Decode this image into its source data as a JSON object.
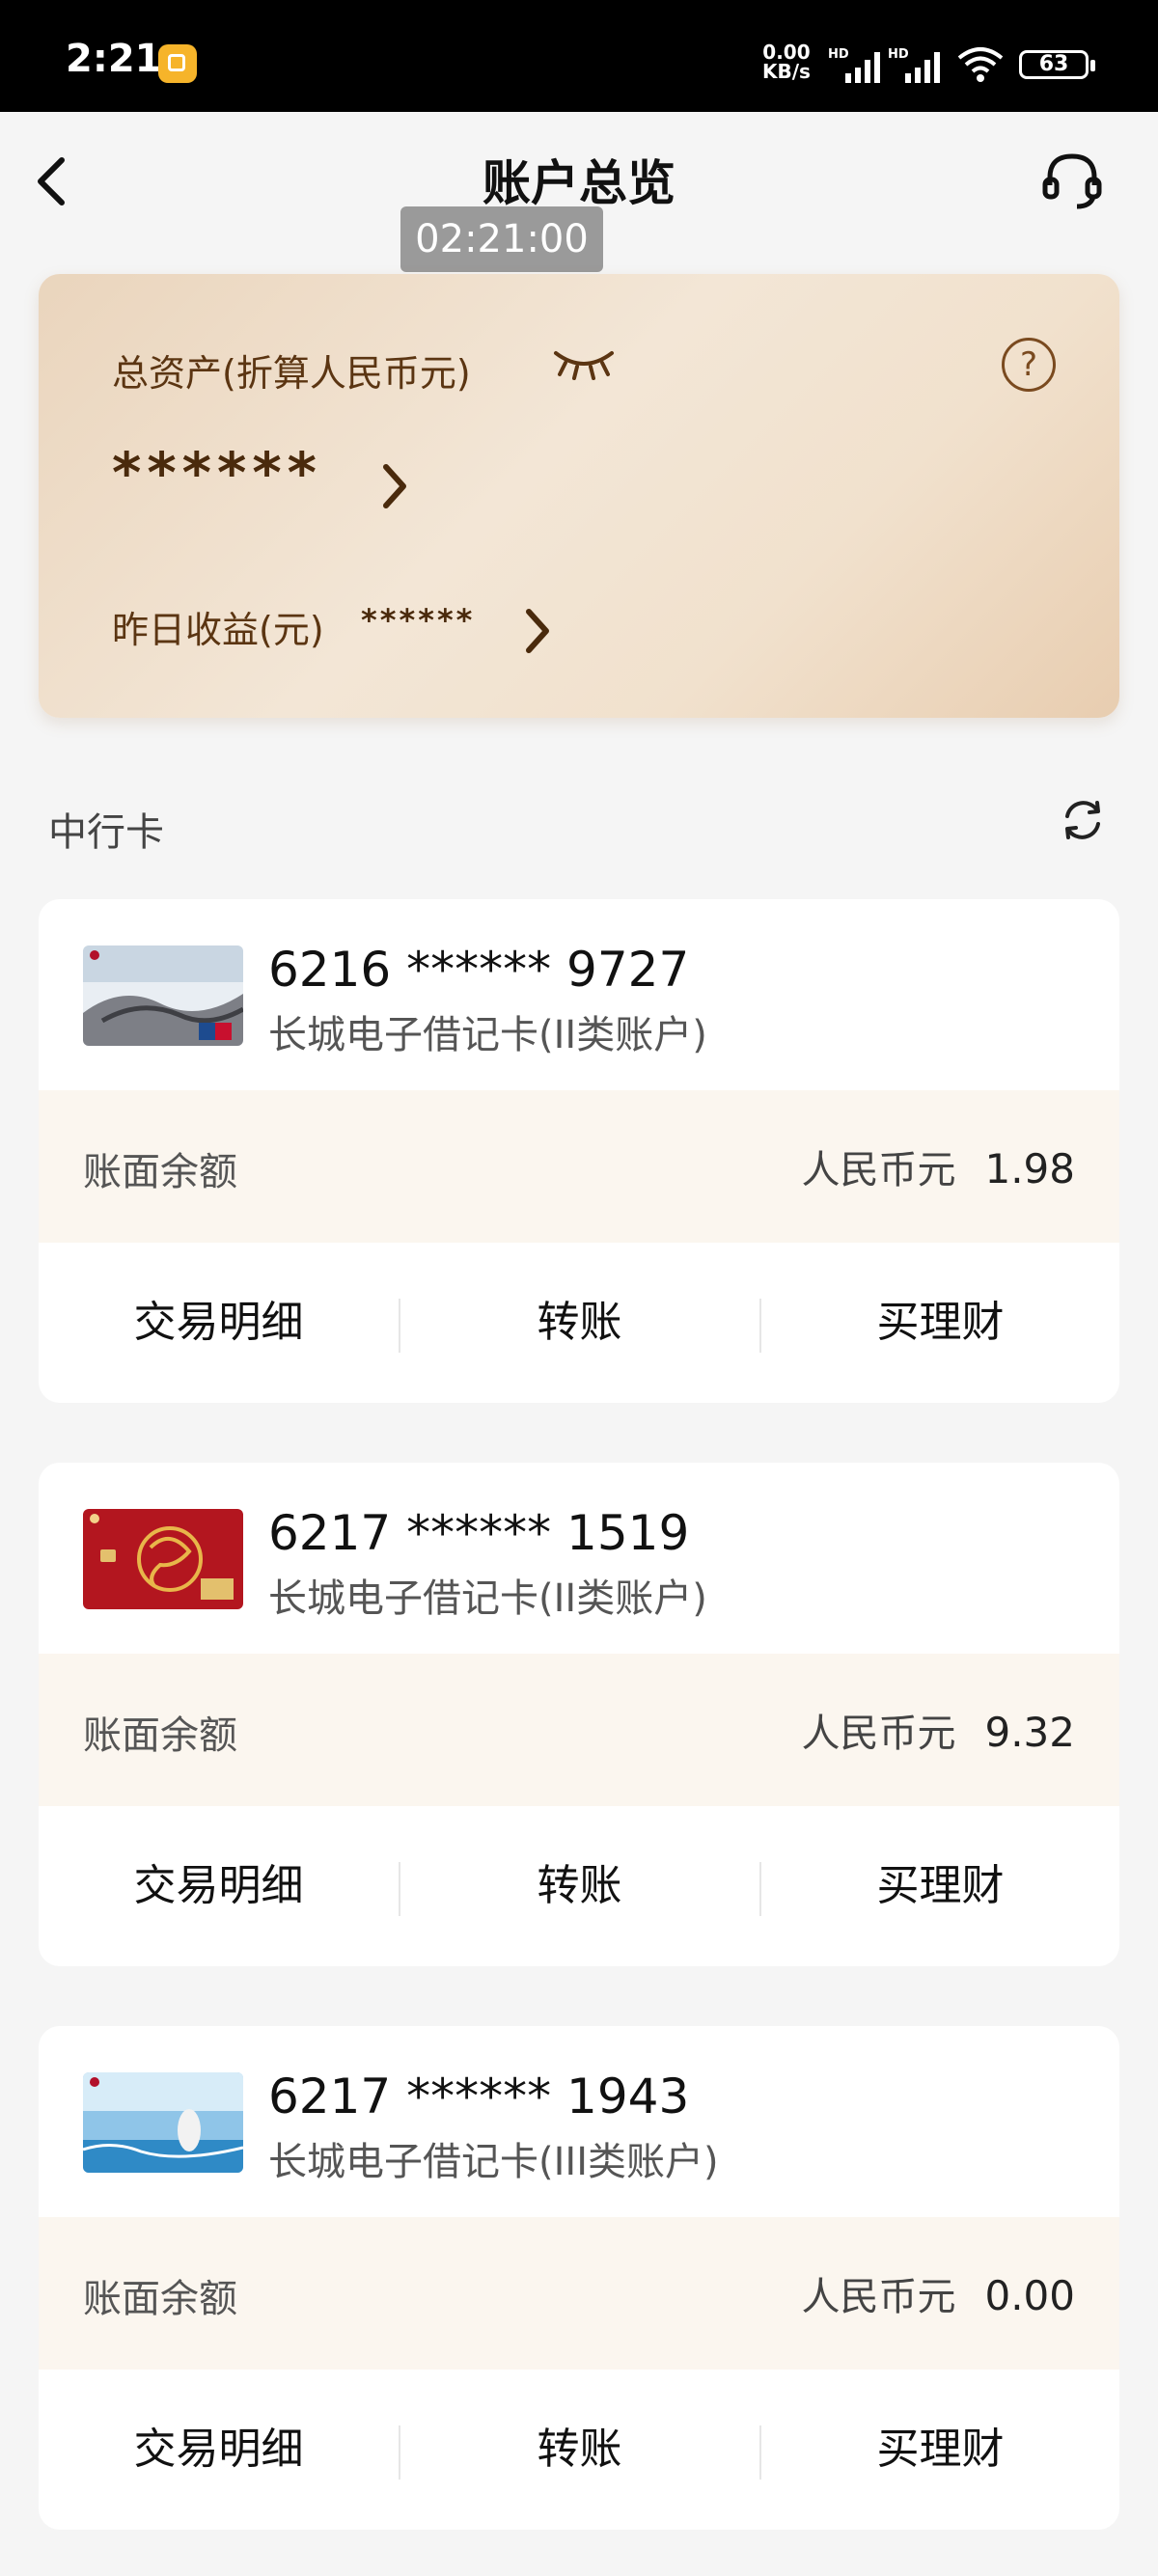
{
  "status_bar": {
    "time": "2:21",
    "speed_value": "0.00",
    "speed_unit": "KB/s",
    "battery": "63"
  },
  "nav": {
    "title": "账户总览",
    "timer": "02:21:00"
  },
  "assets": {
    "total_label": "总资产(折算人民币元)",
    "total_value": "******",
    "yesterday_label": "昨日收益(元)",
    "yesterday_value": "******"
  },
  "section": {
    "title": "中行卡"
  },
  "accounts": [
    {
      "number": "6216 ****** 9727",
      "type": "长城电子借记卡(II类账户)",
      "balance_label": "账面余额",
      "currency": "人民币元",
      "balance": "1.98",
      "actions": [
        "交易明细",
        "转账",
        "买理财"
      ]
    },
    {
      "number": "6217 ****** 1519",
      "type": "长城电子借记卡(II类账户)",
      "balance_label": "账面余额",
      "currency": "人民币元",
      "balance": "9.32",
      "actions": [
        "交易明细",
        "转账",
        "买理财"
      ]
    },
    {
      "number": "6217 ****** 1943",
      "type": "长城电子借记卡(III类账户)",
      "balance_label": "账面余额",
      "currency": "人民币元",
      "balance": "0.00",
      "actions": [
        "交易明细",
        "转账",
        "买理财"
      ]
    }
  ],
  "icons": {
    "back": "back-arrow-icon",
    "service": "headset-icon",
    "eye": "eye-closed-icon",
    "help": "question-icon",
    "refresh": "refresh-icon"
  },
  "colors": {
    "asset_card_start": "#ead5bd",
    "asset_text": "#5b3512",
    "balance_row_bg": "#fbf6ef"
  }
}
